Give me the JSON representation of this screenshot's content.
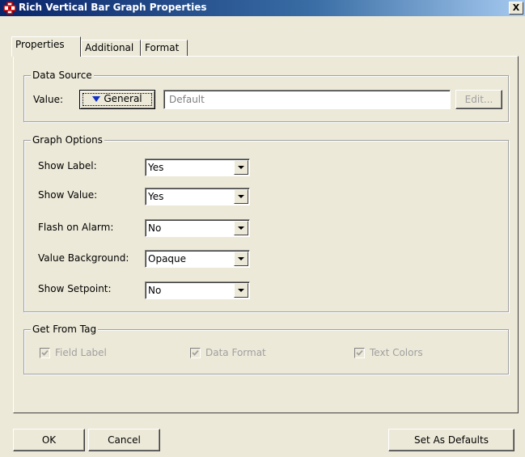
{
  "window": {
    "title": "Rich Vertical Bar Graph Properties",
    "close_label": "X"
  },
  "tabs": [
    {
      "label": "Properties",
      "active": true
    },
    {
      "label": "Additional",
      "active": false
    },
    {
      "label": "Format",
      "active": false
    }
  ],
  "data_source": {
    "group_label": "Data Source",
    "value_label": "Value:",
    "general_button": "General",
    "input_value": "Default",
    "edit_button": "Edit..."
  },
  "graph_options": {
    "group_label": "Graph Options",
    "rows": [
      {
        "label": "Show Label:",
        "value": "Yes"
      },
      {
        "label": "Show Value:",
        "value": "Yes"
      },
      {
        "label": "Flash on Alarm:",
        "value": "No"
      },
      {
        "label": "Value Background:",
        "value": "Opaque"
      },
      {
        "label": "Show Setpoint:",
        "value": "No"
      }
    ]
  },
  "get_from_tag": {
    "group_label": "Get From Tag",
    "field_label": {
      "label": "Field Label",
      "checked": true,
      "enabled": false
    },
    "data_format": {
      "label": "Data Format",
      "checked": true,
      "enabled": false
    },
    "text_colors": {
      "label": "Text Colors",
      "checked": true,
      "enabled": false
    }
  },
  "buttons": {
    "ok": "OK",
    "cancel": "Cancel",
    "set_defaults": "Set As Defaults"
  },
  "colors": {
    "dialog_bg": "#ece9d8",
    "title_bar": "#0a246a",
    "title_text": "#ffffff",
    "disabled_text": "#a0a0a0",
    "arrow_blue": "#1030c8"
  }
}
